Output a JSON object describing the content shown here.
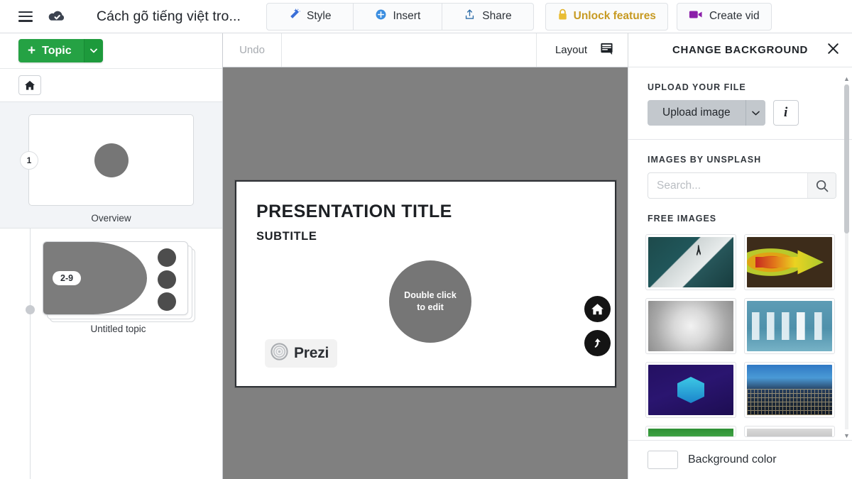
{
  "topbar": {
    "menu_icon": "hamburger-icon",
    "cloud_icon": "cloud-saved-icon",
    "doc_title": "Cách gõ tiếng việt tro...",
    "buttons": [
      {
        "label": "Style",
        "icon": "magic-wand-icon"
      },
      {
        "label": "Insert",
        "icon": "plus-circle-icon"
      },
      {
        "label": "Share",
        "icon": "share-upload-icon"
      }
    ],
    "unlock": {
      "label": "Unlock features",
      "icon": "lock-icon",
      "color": "#c79a22"
    },
    "create_video": {
      "label": "Create vid",
      "icon": "video-camera-icon",
      "color": "#8b1fa9"
    }
  },
  "sidebar": {
    "topic_button": {
      "label": "Topic",
      "plus": "+",
      "caret": "chevron-down-icon",
      "color": "#25a244"
    },
    "home_icon": "home-icon",
    "overview": {
      "number": "1",
      "label": "Overview"
    },
    "topic": {
      "badge": "2-9",
      "label": "Untitled topic"
    }
  },
  "canvas": {
    "undo_label": "Undo",
    "layout_label": "Layout",
    "layout_icon": "layout-panel-icon",
    "slide": {
      "title": "PRESENTATION TITLE",
      "subtitle": "SUBTITLE",
      "circle_line1": "Double click",
      "circle_line2": "to edit",
      "logo_text": "Prezi",
      "logo_icon": "prezi-spiral-icon"
    },
    "fab_home_icon": "home-icon",
    "fab_up_icon": "arrow-up-curve-icon"
  },
  "panel": {
    "title": "CHANGE BACKGROUND",
    "close_icon": "close-icon",
    "upload_section_label": "UPLOAD YOUR FILE",
    "upload_button_label": "Upload image",
    "upload_caret_icon": "chevron-down-icon",
    "info_button_label": "i",
    "unsplash_section_label": "IMAGES BY UNSPLASH",
    "search_placeholder": "Search...",
    "search_value": "",
    "search_icon": "search-icon",
    "free_images_label": "FREE IMAGES",
    "images": [
      {
        "name": "diver-on-white-ramp",
        "class": "ph-diver"
      },
      {
        "name": "colorful-arrow-candy",
        "class": "ph-arrow"
      },
      {
        "name": "grey-radial-gradient",
        "class": "ph-radial"
      },
      {
        "name": "blue-arrows-up-down",
        "class": "ph-arrows-blue"
      },
      {
        "name": "isometric-servers-navy",
        "class": "ph-server"
      },
      {
        "name": "city-skyline-night",
        "class": "ph-city"
      }
    ],
    "partial_images": [
      {
        "name": "green-gradient",
        "class": "ph-green"
      },
      {
        "name": "grey-gradient",
        "class": "ph-grey"
      }
    ],
    "footer": {
      "color_label": "Background color",
      "swatch_color": "#ffffff"
    }
  }
}
